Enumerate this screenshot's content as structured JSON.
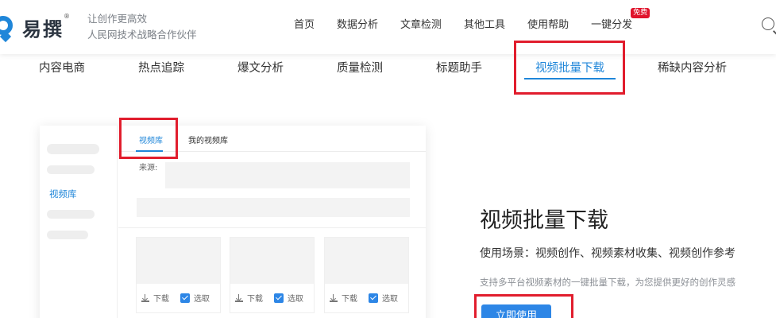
{
  "logo": {
    "text": "易撰",
    "mark": "®"
  },
  "slogan": {
    "line1": "让创作更高效",
    "line2": "人民网技术战略合作伙伴"
  },
  "nav": {
    "items": [
      "首页",
      "数据分析",
      "文章检测",
      "其他工具",
      "使用帮助",
      "一键分发"
    ],
    "badge": "免费"
  },
  "icons": {
    "search": "search-icon",
    "download": "download-icon",
    "checkbox": "checkbox-checked-icon"
  },
  "subnav": {
    "items": [
      "内容电商",
      "热点追踪",
      "爆文分析",
      "质量检测",
      "标题助手",
      "视频批量下载",
      "稀缺内容分析"
    ],
    "active": "视频批量下载"
  },
  "mock": {
    "side_active": "视频库",
    "tabs": [
      "视频库",
      "我的视频库"
    ],
    "source_label": "来源:",
    "tiles": [
      {
        "download": "下载",
        "select": "选取"
      },
      {
        "download": "下载",
        "select": "选取"
      },
      {
        "download": "下载",
        "select": "选取"
      }
    ]
  },
  "feature": {
    "title": "视频批量下载",
    "scenario": "使用场景：视频创作、视频素材收集、视频创作参考",
    "description": "支持多平台视频素材的一键批量下载，为您提供更好的创作灵感",
    "cta": "立即使用"
  },
  "colors": {
    "accent": "#1f86d9",
    "highlight": "#e11d2d",
    "button": "#2d86e6"
  }
}
